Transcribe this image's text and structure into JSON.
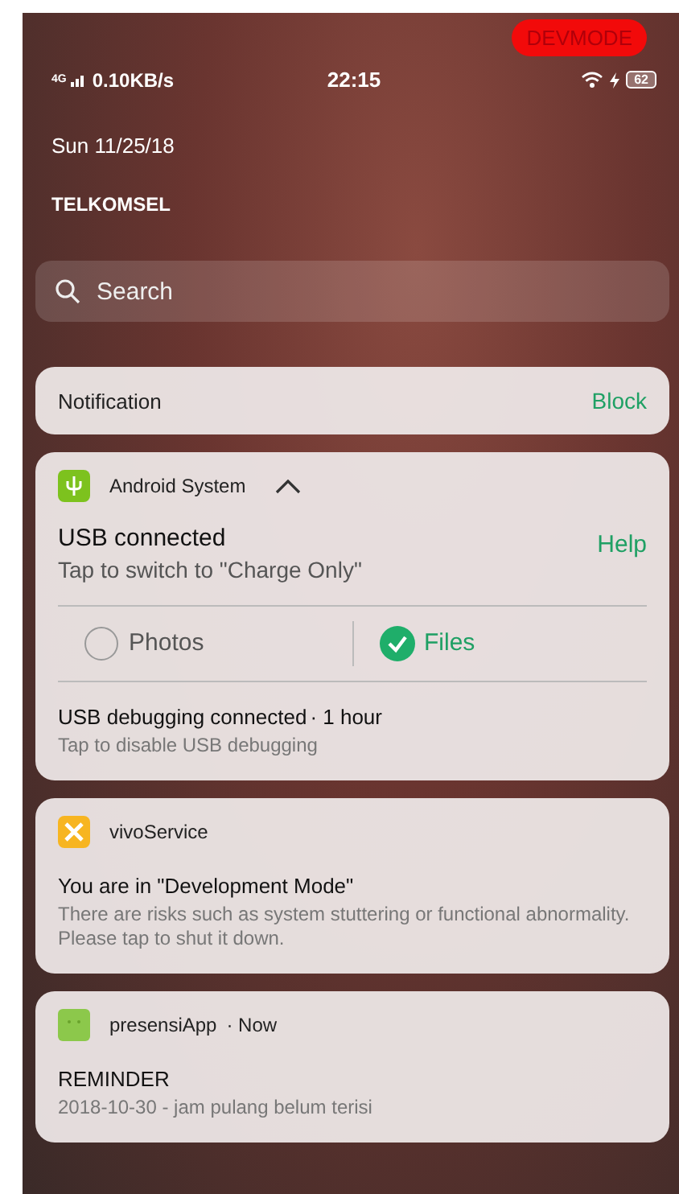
{
  "devmode_badge": "DEVMODE",
  "status_bar": {
    "network": "4G",
    "speed": "0.10KB/s",
    "time": "22:15",
    "battery": "62",
    "charging": true
  },
  "date": "Sun 11/25/18",
  "carrier": "TELKOMSEL",
  "search": {
    "placeholder": "Search"
  },
  "notification_bar": {
    "label": "Notification",
    "action": "Block"
  },
  "notifications": [
    {
      "kind": "usb",
      "app": "Android System",
      "expanded": true,
      "title": "USB connected",
      "text": "Tap to switch to \"Charge Only\"",
      "action": "Help",
      "options": [
        {
          "label": "Photos",
          "selected": false
        },
        {
          "label": "Files",
          "selected": true
        }
      ],
      "secondary_title": "USB debugging connected",
      "secondary_time": "· 1 hour",
      "secondary_text": "Tap to disable USB debugging"
    },
    {
      "kind": "service",
      "app": "vivoService",
      "title": "You are in \"Development Mode\"",
      "text": "There are risks such as system stuttering or functional abnormality. Please tap to shut it down."
    },
    {
      "kind": "reminder",
      "app": "presensiApp",
      "time": "· Now",
      "title": "REMINDER",
      "text": "2018-10-30 - jam pulang belum terisi"
    }
  ]
}
